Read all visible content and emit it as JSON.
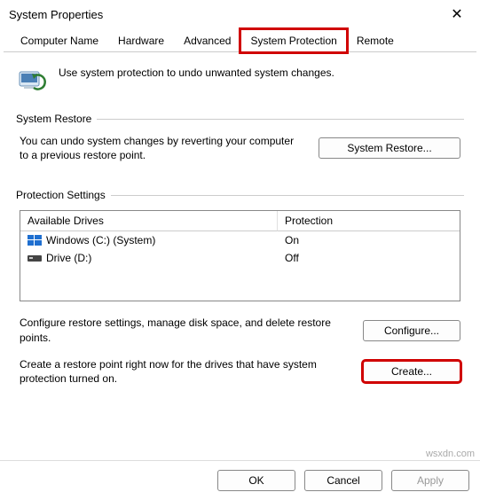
{
  "window": {
    "title": "System Properties",
    "close_glyph": "✕"
  },
  "tabs": {
    "items": [
      {
        "label": "Computer Name"
      },
      {
        "label": "Hardware"
      },
      {
        "label": "Advanced"
      },
      {
        "label": "System Protection"
      },
      {
        "label": "Remote"
      }
    ]
  },
  "intro": {
    "text": "Use system protection to undo unwanted system changes."
  },
  "restore_group": {
    "label": "System Restore",
    "text": "You can undo system changes by reverting your computer to a previous restore point.",
    "button": "System Restore..."
  },
  "protection_group": {
    "label": "Protection Settings",
    "columns": {
      "drive": "Available Drives",
      "protection": "Protection"
    },
    "rows": [
      {
        "icon": "windows-drive-icon",
        "name": "Windows (C:) (System)",
        "protection": "On"
      },
      {
        "icon": "drive-icon",
        "name": "Drive (D:)",
        "protection": "Off"
      }
    ],
    "configure": {
      "text": "Configure restore settings, manage disk space, and delete restore points.",
      "button": "Configure..."
    },
    "create": {
      "text": "Create a restore point right now for the drives that have system protection turned on.",
      "button": "Create..."
    }
  },
  "bottom": {
    "ok": "OK",
    "cancel": "Cancel",
    "apply": "Apply"
  },
  "watermark": "wsxdn.com"
}
